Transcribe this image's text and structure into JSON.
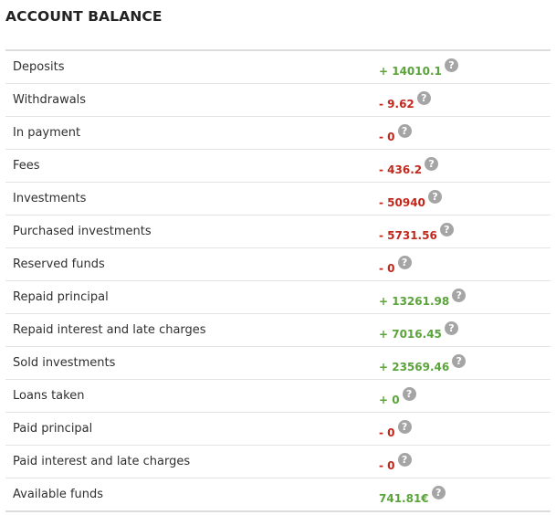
{
  "title": "ACCOUNT BALANCE",
  "help_glyph": "?",
  "colors": {
    "positive": "#5ba33b",
    "negative": "#c0281c",
    "help_icon": "#a5a5a5"
  },
  "rows": [
    {
      "label": "Deposits",
      "value": "+ 14010.1",
      "sign": "positive"
    },
    {
      "label": "Withdrawals",
      "value": "- 9.62",
      "sign": "negative"
    },
    {
      "label": "In payment",
      "value": "- 0",
      "sign": "negative"
    },
    {
      "label": "Fees",
      "value": "- 436.2",
      "sign": "negative"
    },
    {
      "label": "Investments",
      "value": "- 50940",
      "sign": "negative"
    },
    {
      "label": "Purchased investments",
      "value": "- 5731.56",
      "sign": "negative"
    },
    {
      "label": "Reserved funds",
      "value": "- 0",
      "sign": "negative"
    },
    {
      "label": "Repaid principal",
      "value": "+ 13261.98",
      "sign": "positive"
    },
    {
      "label": "Repaid interest and late charges",
      "value": "+ 7016.45",
      "sign": "positive"
    },
    {
      "label": "Sold investments",
      "value": "+ 23569.46",
      "sign": "positive"
    },
    {
      "label": "Loans taken",
      "value": "+ 0",
      "sign": "positive"
    },
    {
      "label": "Paid principal",
      "value": "- 0",
      "sign": "negative"
    },
    {
      "label": "Paid interest and late charges",
      "value": "- 0",
      "sign": "negative"
    },
    {
      "label": "Available funds",
      "value": "741.81€",
      "sign": "positive"
    }
  ]
}
